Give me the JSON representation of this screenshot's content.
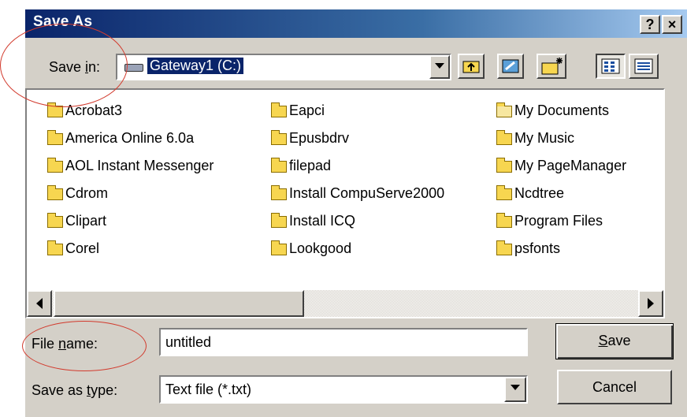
{
  "dialog": {
    "title": "Save As",
    "help_label": "?",
    "close_label": "×"
  },
  "save_in": {
    "label_pre": "Save ",
    "label_hot": "i",
    "label_post": "n:",
    "value": "Gateway1 (C:)"
  },
  "files": [
    {
      "name": "Acrobat3",
      "icon": "folder-icon"
    },
    {
      "name": "America Online 6.0a",
      "icon": "folder-icon"
    },
    {
      "name": "AOL Instant Messenger",
      "icon": "folder-icon"
    },
    {
      "name": "Cdrom",
      "icon": "folder-icon"
    },
    {
      "name": "Clipart",
      "icon": "folder-icon"
    },
    {
      "name": "Corel",
      "icon": "folder-icon"
    },
    {
      "name": "Eapci",
      "icon": "folder-icon"
    },
    {
      "name": "Epusbdrv",
      "icon": "folder-icon"
    },
    {
      "name": "filepad",
      "icon": "folder-icon"
    },
    {
      "name": "Install CompuServe2000",
      "icon": "folder-icon"
    },
    {
      "name": "Install ICQ",
      "icon": "folder-icon"
    },
    {
      "name": "Lookgood",
      "icon": "folder-icon"
    },
    {
      "name": "My Documents",
      "icon": "my-documents-icon"
    },
    {
      "name": "My Music",
      "icon": "folder-icon"
    },
    {
      "name": "My PageManager",
      "icon": "folder-icon"
    },
    {
      "name": "Ncdtree",
      "icon": "folder-icon"
    },
    {
      "name": "Program Files",
      "icon": "folder-icon"
    },
    {
      "name": "psfonts",
      "icon": "folder-icon"
    }
  ],
  "file_name": {
    "label_pre": "File ",
    "label_hot": "n",
    "label_post": "ame:",
    "value": "untitled"
  },
  "save_type": {
    "label_pre": "Save as ",
    "label_hot": "t",
    "label_post": "ype:",
    "value": "Text file (*.txt)"
  },
  "buttons": {
    "save_hot": "S",
    "save_rest": "ave",
    "cancel": "Cancel"
  },
  "colors": {
    "title_bar_start": "#0a246a",
    "title_bar_end": "#a6caf0",
    "dialog_face": "#d4d0c8",
    "selection": "#0a246a",
    "annotation": "#d23b2e"
  }
}
